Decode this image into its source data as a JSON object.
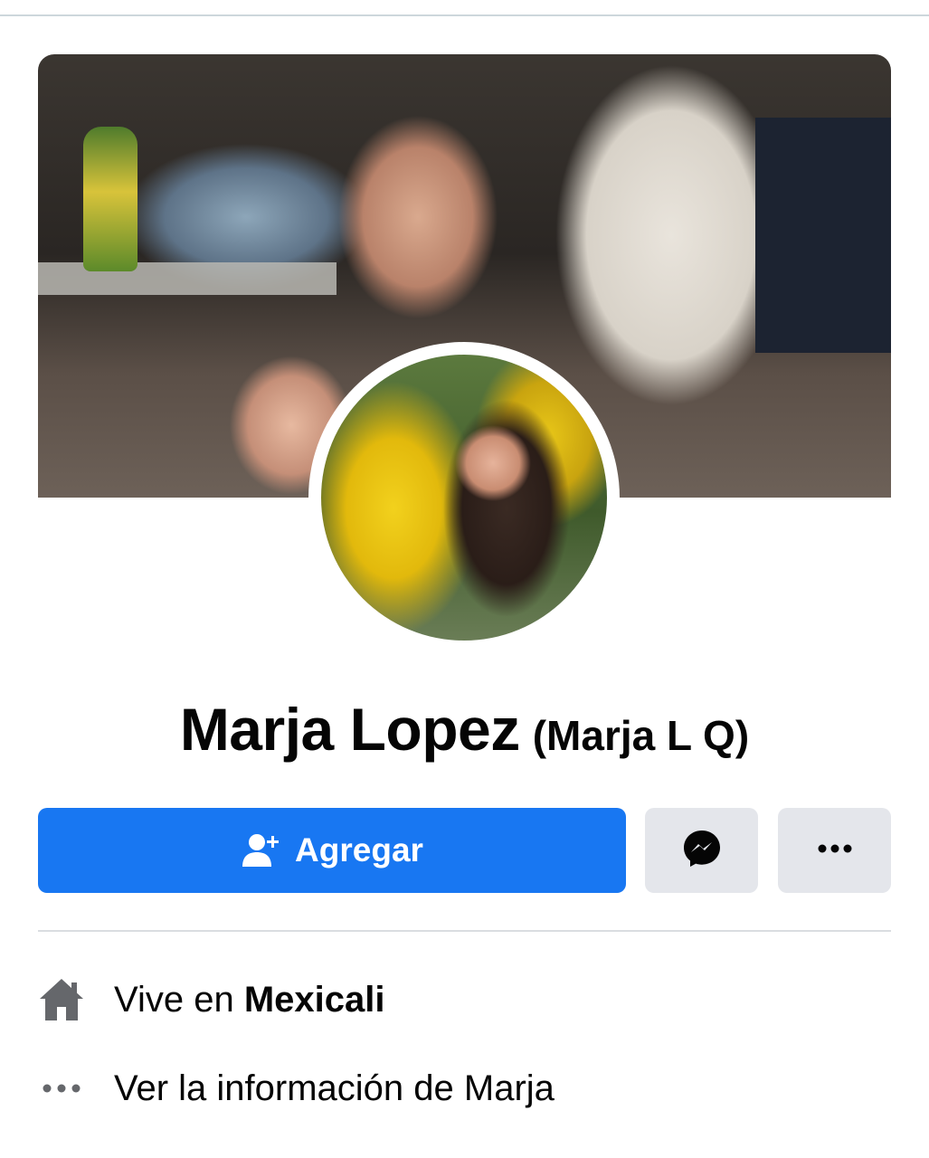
{
  "profile": {
    "name": "Marja Lopez",
    "alternate_name": "(Marja L Q)"
  },
  "actions": {
    "add_label": "Agregar",
    "add_icon": "person-add-icon",
    "messenger_icon": "messenger-icon",
    "more_icon": "more-dots-icon",
    "primary_color": "#1877f2",
    "secondary_color": "#e4e6eb"
  },
  "details": {
    "city_prefix": "Vive en",
    "city_name": "Mexicali",
    "city_icon": "home-icon",
    "about_text": "Ver la información de Marja",
    "about_icon": "more-dots-icon"
  }
}
